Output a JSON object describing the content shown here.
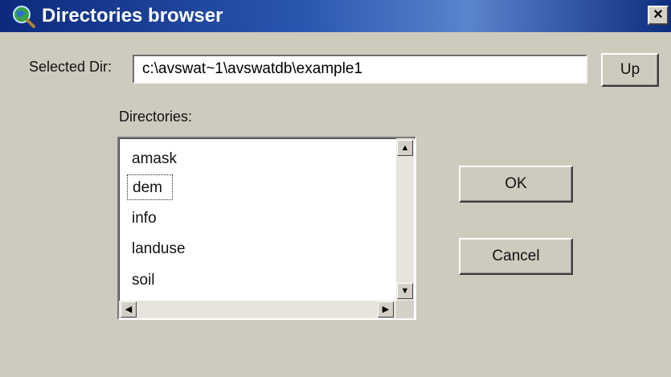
{
  "window": {
    "title": "Directories browser",
    "icon": "globe-magnifier-icon",
    "close_label": "×"
  },
  "form": {
    "selected_dir_label": "Selected Dir:",
    "selected_dir_value": "c:\\avswat~1\\avswatdb\\example1",
    "up_label": "Up",
    "directories_label": "Directories:",
    "directories": [
      "amask",
      "dem",
      "info",
      "landuse",
      "soil"
    ],
    "focused_directory": "dem",
    "ok_label": "OK",
    "cancel_label": "Cancel"
  },
  "colors": {
    "titlebar": "#0c2a7d",
    "dialog_bg": "#cdcbbe"
  }
}
